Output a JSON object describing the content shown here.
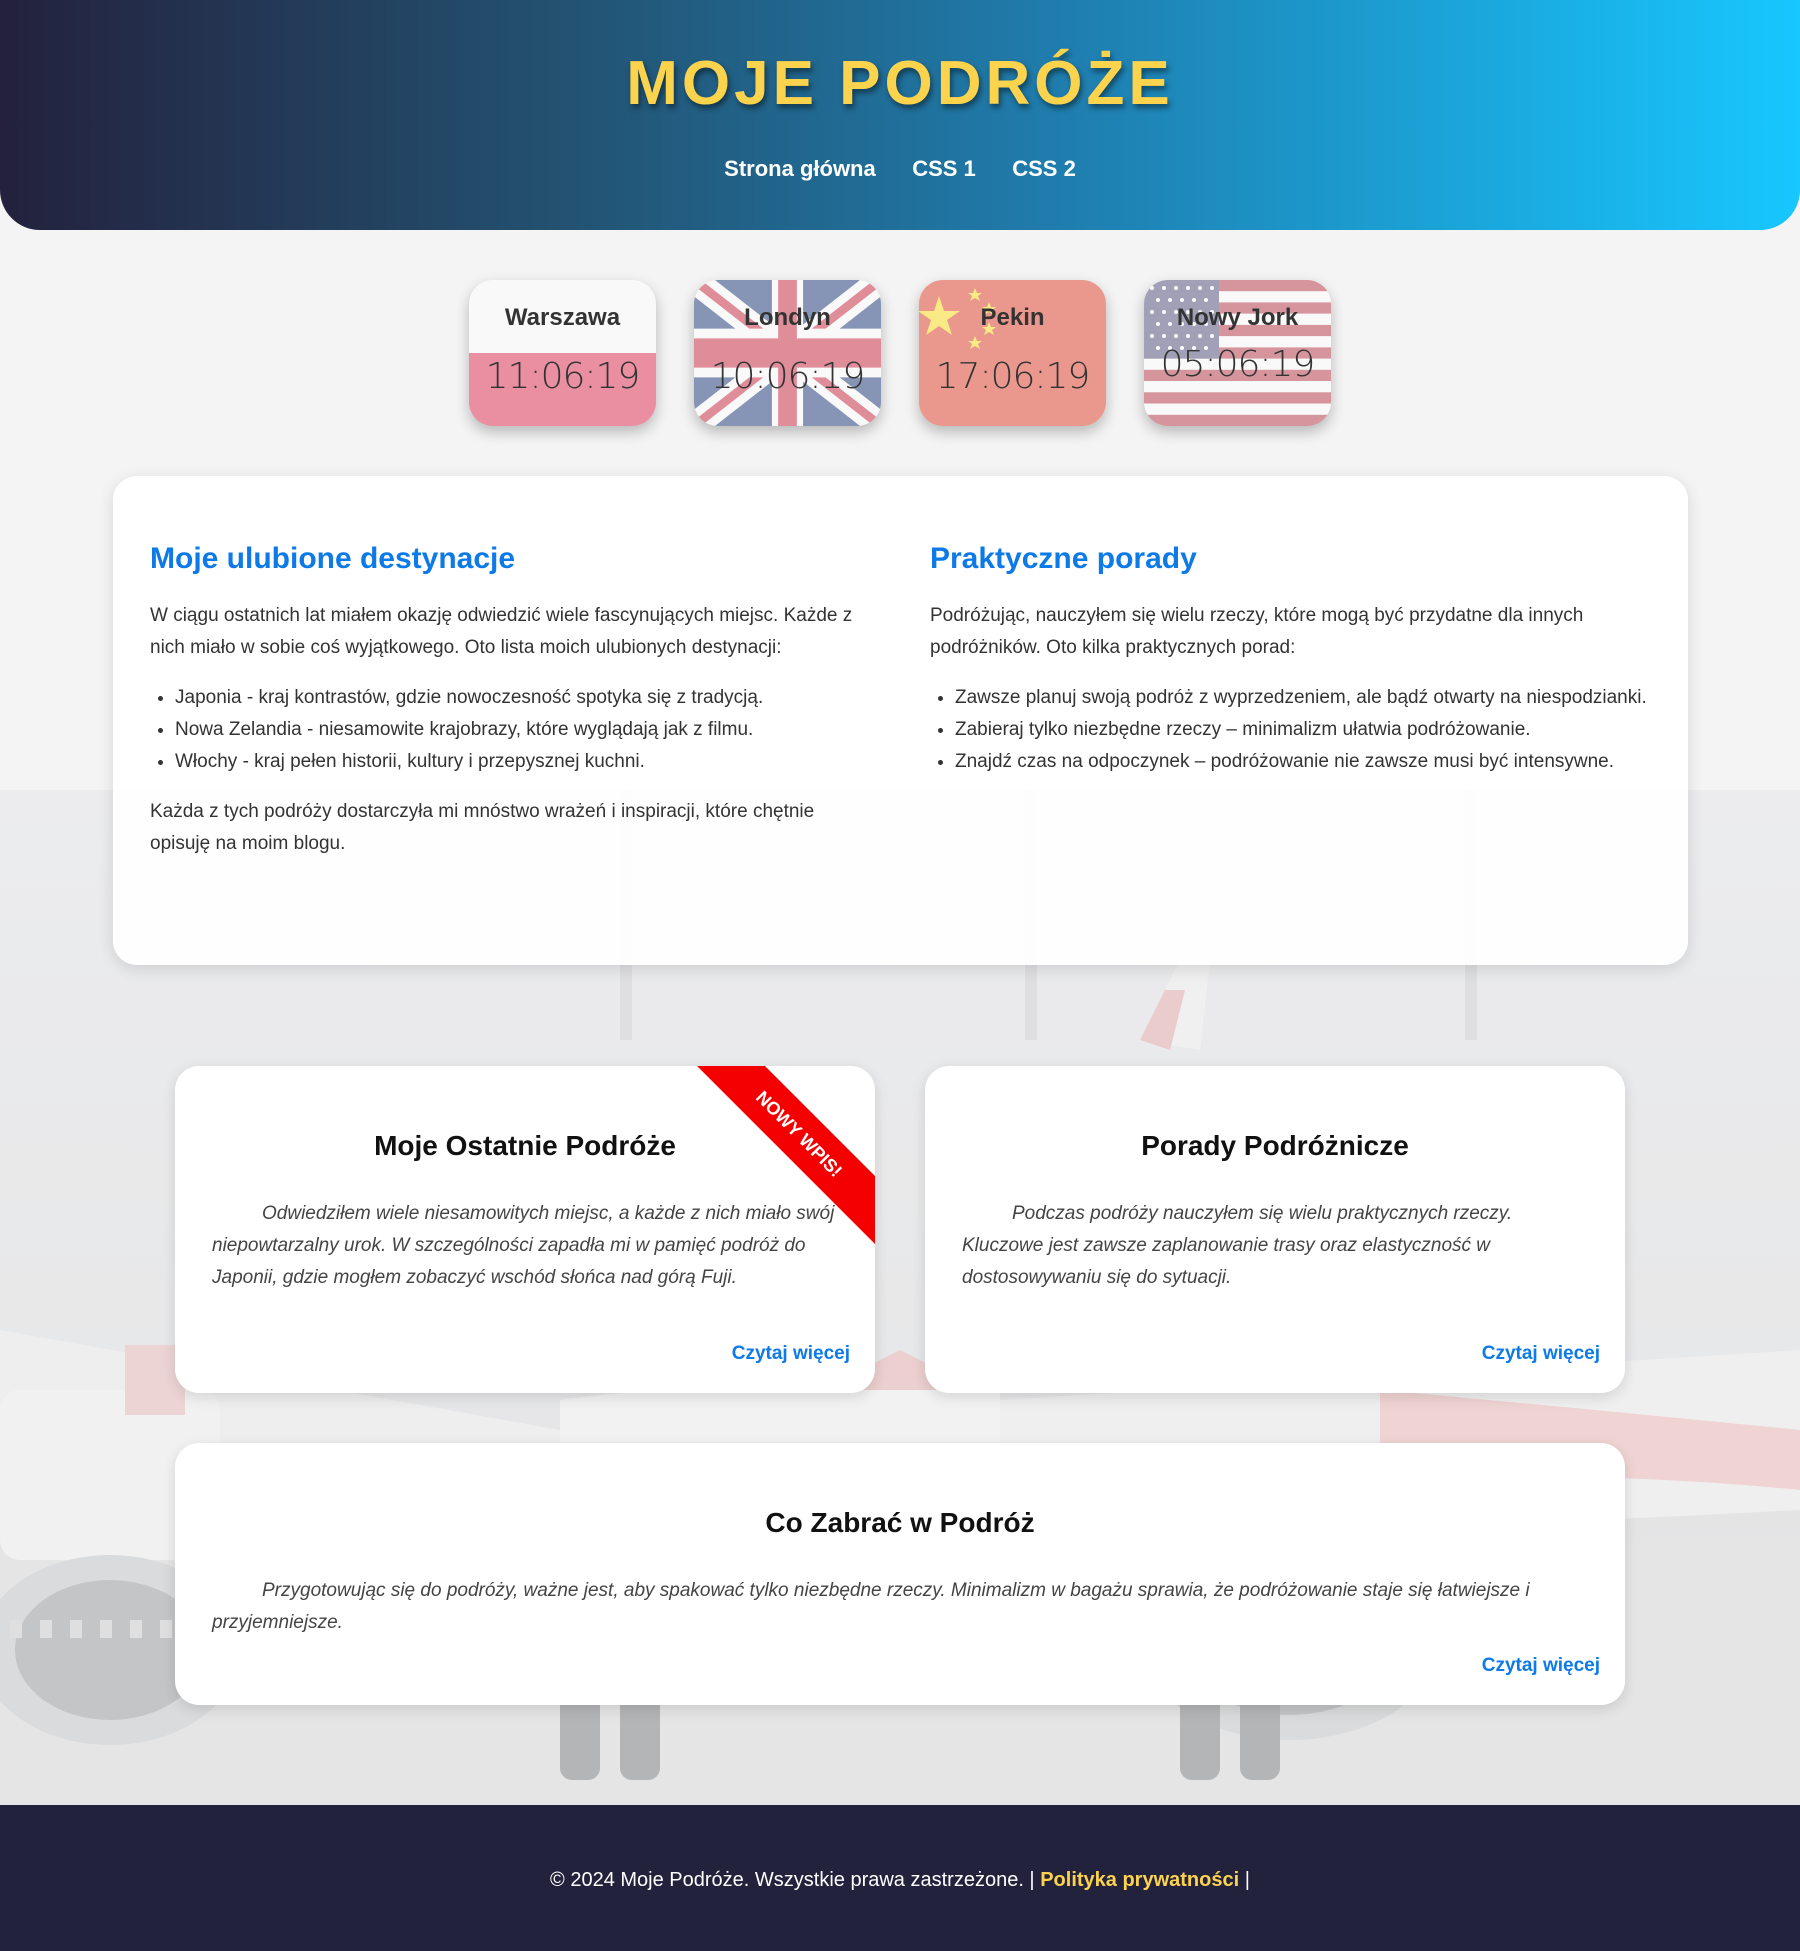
{
  "header": {
    "title": "MOJE PODRÓŻE",
    "nav": [
      "Strona główna",
      "CSS 1",
      "CSS 2"
    ]
  },
  "clocks": [
    {
      "city": "Warszawa",
      "time": "11:06:19",
      "flag": "poland"
    },
    {
      "city": "Londyn",
      "time": "10:06:19",
      "flag": "united-kingdom"
    },
    {
      "city": "Pekin",
      "time": "17:06:19",
      "flag": "china"
    },
    {
      "city": "Nowy Jork",
      "time": "05:06:19",
      "flag": "united-states"
    }
  ],
  "info": {
    "left": {
      "heading": "Moje ulubione destynacje",
      "intro": "W ciągu ostatnich lat miałem okazję odwiedzić wiele fascynujących miejsc. Każde z nich miało w sobie coś wyjątkowego. Oto lista moich ulubionych destynacji:",
      "items": [
        "Japonia - kraj kontrastów, gdzie nowoczesność spotyka się z tradycją.",
        "Nowa Zelandia - niesamowite krajobrazy, które wyglądają jak z filmu.",
        "Włochy - kraj pełen historii, kultury i przepysznej kuchni."
      ],
      "outro": "Każda z tych podróży dostarczyła mi mnóstwo wrażeń i inspiracji, które chętnie opisuję na moim blogu."
    },
    "right": {
      "heading": "Praktyczne porady",
      "intro": "Podróżując, nauczyłem się wielu rzeczy, które mogą być przydatne dla innych podróżników. Oto kilka praktycznych porad:",
      "items": [
        "Zawsze planuj swoją podróż z wyprzedzeniem, ale bądź otwarty na niespodzianki.",
        "Zabieraj tylko niezbędne rzeczy – minimalizm ułatwia podróżowanie.",
        "Znajdź czas na odpoczynek – podróżowanie nie zawsze musi być intensywne."
      ]
    }
  },
  "cards": [
    {
      "title": "Moje Ostatnie Podróże",
      "text": "Odwiedziłem wiele niesamowitych miejsc, a każde z nich miało swój niepowtarzalny urok. W szczególności zapadła mi w pamięć podróż do Japonii, gdzie mogłem zobaczyć wschód słońca nad górą Fuji.",
      "link": "Czytaj więcej",
      "ribbon": "NOWY WPIS!"
    },
    {
      "title": "Porady Podróżnicze",
      "text": "Podczas podróży nauczyłem się wielu praktycznych rzeczy. Kluczowe jest zawsze zaplanowanie trasy oraz elastyczność w dostosowywaniu się do sytuacji.",
      "link": "Czytaj więcej"
    },
    {
      "title": "Co Zabrać w Podróż",
      "text": "Przygotowując się do podróży, ważne jest, aby spakować tylko niezbędne rzeczy. Minimalizm w bagażu sprawia, że podróżowanie staje się łatwiejsze i przyjemniejsze.",
      "link": "Czytaj więcej"
    }
  ],
  "footer": {
    "text": "© 2024 Moje Podróże. Wszystkie prawa zastrzeżone. |",
    "privacy": "Polityka prywatności",
    "suffix": "|"
  },
  "colors": {
    "accent": "#0d7ae8",
    "title": "#fcd34d",
    "ribbon": "#f50000",
    "footer_bg": "#23223d"
  }
}
